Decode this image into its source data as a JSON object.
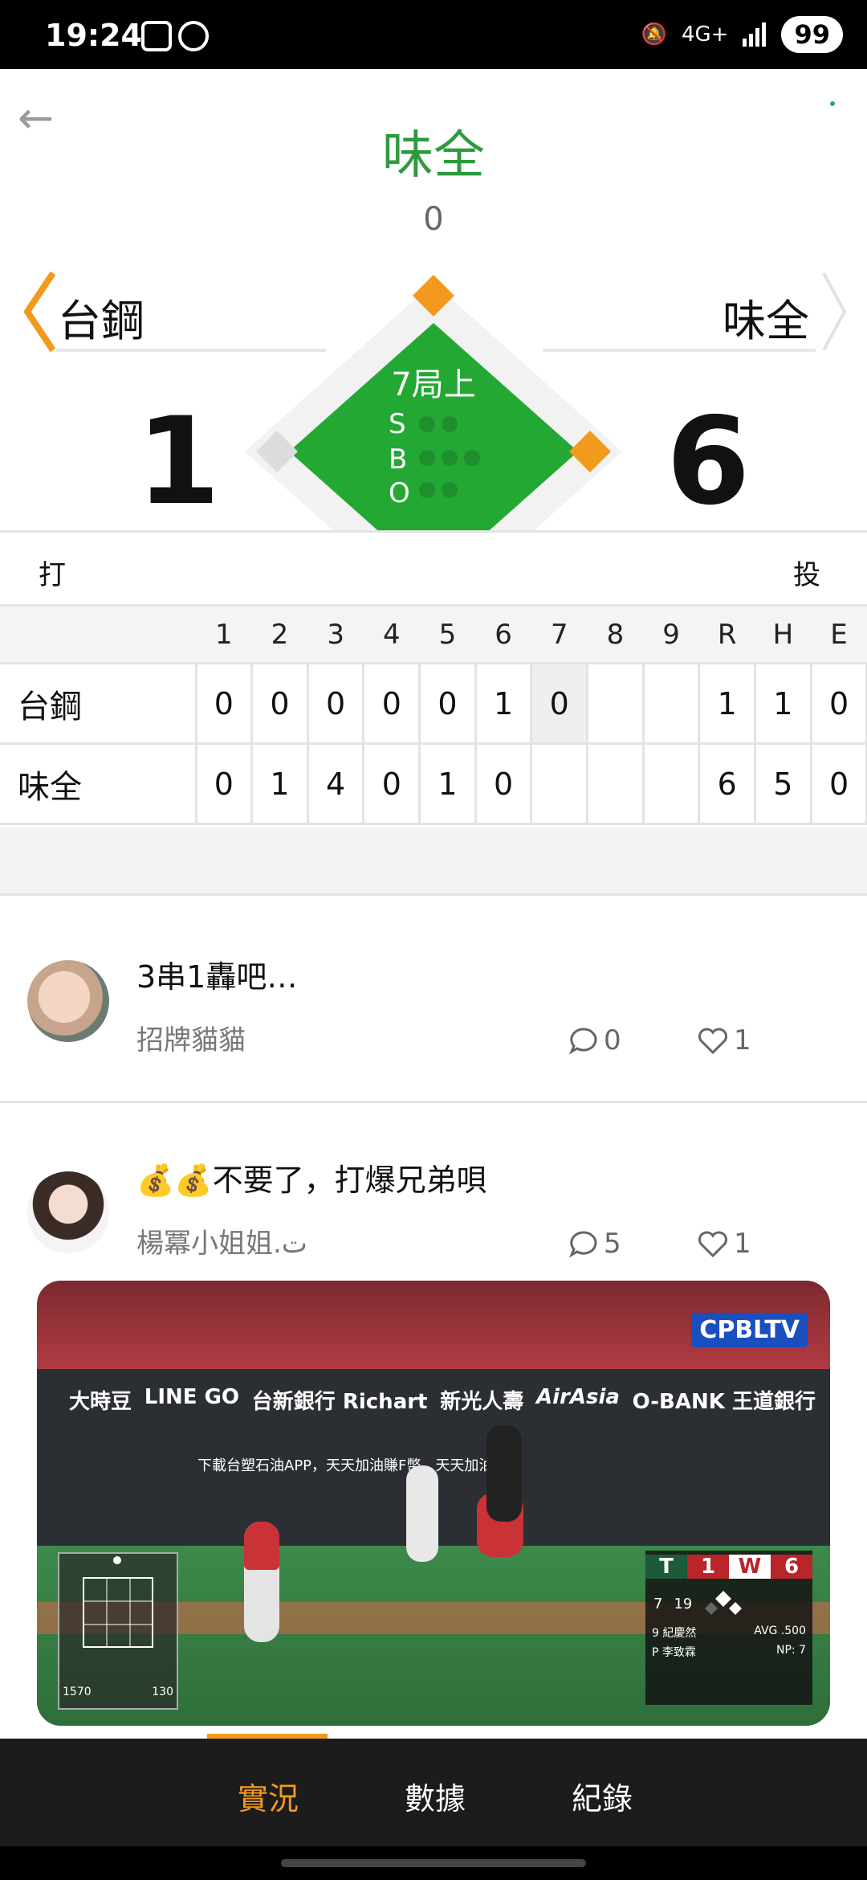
{
  "status_bar": {
    "time": "19:24",
    "network": "4G+",
    "battery": "99"
  },
  "header": {
    "title": "味全",
    "title_score": "0"
  },
  "scoreboard": {
    "away_team": "台鋼",
    "home_team": "味全",
    "away_score": "1",
    "home_score": "6",
    "inning": "7局上",
    "count_labels": [
      "S",
      "B",
      "O"
    ],
    "batting_label": "打",
    "pitching_label": "投"
  },
  "linescore": {
    "headers": [
      "",
      "1",
      "2",
      "3",
      "4",
      "5",
      "6",
      "7",
      "8",
      "9",
      "R",
      "H",
      "E"
    ],
    "rows": [
      {
        "team": "台鋼",
        "innings": [
          "0",
          "0",
          "0",
          "0",
          "0",
          "1",
          "0",
          "",
          "",
          ""
        ],
        "r": "1",
        "h": "1",
        "e": "0"
      },
      {
        "team": "味全",
        "innings": [
          "0",
          "1",
          "4",
          "0",
          "1",
          "0",
          "",
          "",
          "",
          ""
        ],
        "r": "6",
        "h": "5",
        "e": "0"
      }
    ]
  },
  "posts": [
    {
      "text": "3串1轟吧…",
      "author": "招牌貓貓",
      "comments": "0",
      "likes": "1"
    },
    {
      "text": "💰💰不要了，打爆兄弟唄",
      "author": "楊冪小姐姐.ت",
      "comments": "5",
      "likes": "1"
    }
  ],
  "video": {
    "brand": "CPBLTV",
    "sponsors": [
      "大時豆",
      "LINE GO",
      "台新銀行 Richart",
      "新光人壽",
      "AirAsia",
      "O-BANK 王道銀行"
    ],
    "banner_text": "下載台塑石油APP，天天加油賺F幣，天天加油超給",
    "scorebug": {
      "away_score": "1",
      "home_score": "6",
      "inning": "7",
      "count": "19",
      "batter": "9 紀慶然",
      "avg": "AVG .500",
      "pitcher": "P 李致霖",
      "np": "NP: 7"
    },
    "speed_left": "1570",
    "speed_right": "130"
  },
  "bottom_nav": {
    "items": [
      "實況",
      "數據",
      "紀錄"
    ],
    "active": 0
  },
  "colors": {
    "accent_green": "#2e9a3e",
    "accent_orange": "#f29a1d",
    "diamond_green": "#23a834"
  }
}
